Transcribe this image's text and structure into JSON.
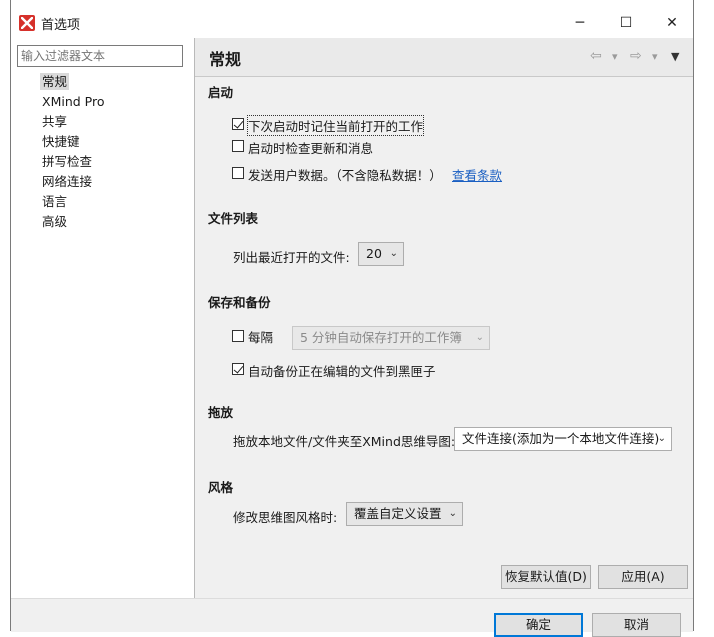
{
  "window": {
    "title": "首选项",
    "minimize": "─",
    "maximize": "☐",
    "close": "✕"
  },
  "sidebar": {
    "filter_placeholder": "输入过滤器文本",
    "items": [
      {
        "label": "常规",
        "selected": true
      },
      {
        "label": "XMind Pro"
      },
      {
        "label": "共享"
      },
      {
        "label": "快捷键"
      },
      {
        "label": "拼写检查"
      },
      {
        "label": "网络连接"
      },
      {
        "label": "语言"
      },
      {
        "label": "高级"
      }
    ]
  },
  "page": {
    "title": "常规",
    "nav": {
      "back": "⇦",
      "back_menu": "▾",
      "forward": "⇨",
      "forward_menu": "▾",
      "view_menu": "▼"
    }
  },
  "startup": {
    "heading": "启动",
    "remember_open": {
      "label": "下次启动时记住当前打开的工作",
      "checked": true
    },
    "check_updates": {
      "label": "启动时检查更新和消息",
      "checked": false
    },
    "send_data": {
      "label": "发送用户数据。（不含隐私数据！）",
      "checked": false
    },
    "terms_link": "查看条款"
  },
  "file_list": {
    "heading": "文件列表",
    "recent_label": "列出最近打开的文件:",
    "recent_value": "20"
  },
  "save_backup": {
    "heading": "保存和备份",
    "every_label": "每隔",
    "every_checked": false,
    "interval_value": "5  分钟自动保存打开的工作簿",
    "auto_backup": {
      "label": "自动备份正在编辑的文件到黑匣子",
      "checked": true
    }
  },
  "drag_drop": {
    "heading": "拖放",
    "label": "拖放本地文件/文件夹至XMind思维导图:",
    "value": "文件连接(添加为一个本地文件连接)"
  },
  "style": {
    "heading": "风格",
    "label": "修改思维图风格时:",
    "value": "覆盖自定义设置"
  },
  "buttons": {
    "restore_defaults": "恢复默认值(D)",
    "apply": "应用(A)",
    "ok": "确定",
    "cancel": "取消"
  },
  "colors": {
    "accent": "#d6312b",
    "link": "#1a5fc2"
  }
}
